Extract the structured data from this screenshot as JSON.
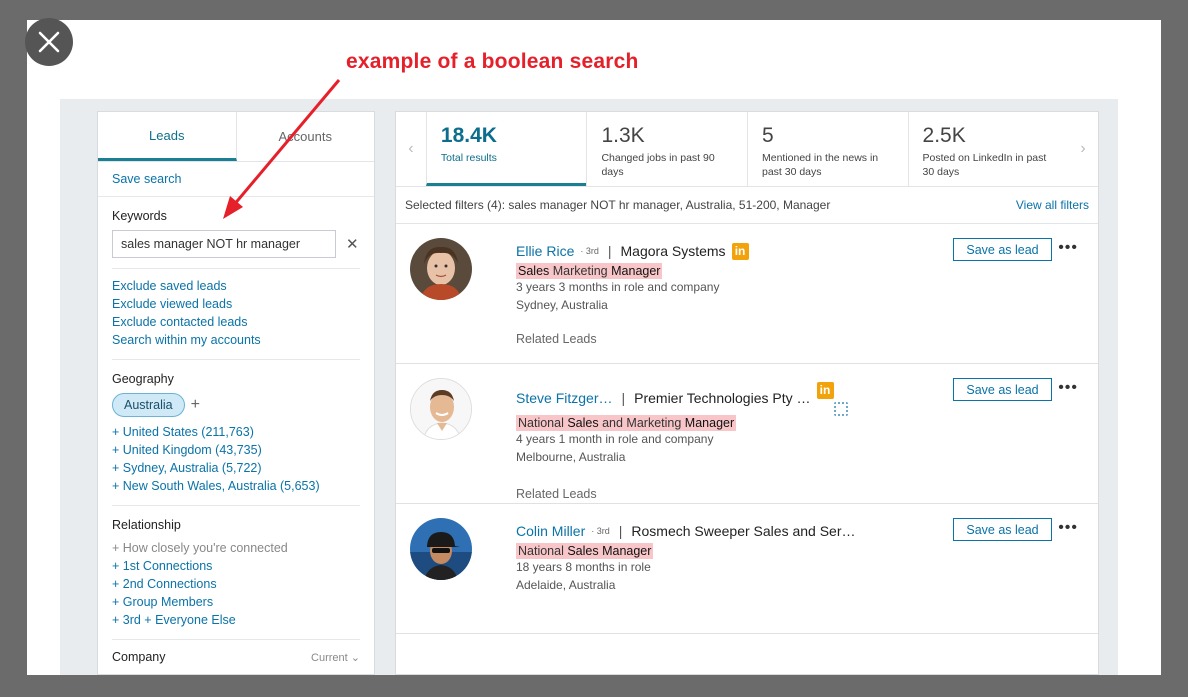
{
  "annotation": "example of a boolean search",
  "tabs": {
    "leads": "Leads",
    "accounts": "Accounts"
  },
  "left": {
    "save_search": "Save search",
    "keywords_title": "Keywords",
    "keywords_value": "sales manager NOT hr manager",
    "exclude_links": [
      "Exclude saved leads",
      "Exclude viewed leads",
      "Exclude contacted leads",
      "Search within my accounts"
    ],
    "geography_title": "Geography",
    "geography_selected": "Australia",
    "geography_options": [
      "+ United States (211,763)",
      "+ United Kingdom (43,735)",
      "+ Sydney, Australia (5,722)",
      "+ New South Wales, Australia (5,653)"
    ],
    "relationship_title": "Relationship",
    "relationship_hint": "How closely you're connected",
    "relationship_options": [
      "+ 1st Connections",
      "+ 2nd Connections",
      "+ Group Members",
      "+ 3rd + Everyone Else"
    ],
    "company_title": "Company",
    "company_current": "Current"
  },
  "stats": [
    {
      "value": "18.4K",
      "label": "Total results"
    },
    {
      "value": "1.3K",
      "label": "Changed jobs in past 90 days"
    },
    {
      "value": "5",
      "label": "Mentioned in the news in past 30 days"
    },
    {
      "value": "2.5K",
      "label": "Posted on LinkedIn in past 30 days"
    }
  ],
  "filters": {
    "text": "Selected filters (4):  sales manager NOT hr manager, Australia, 51-200, Manager",
    "view_all": "View all filters"
  },
  "leads": [
    {
      "name": "Ellie Rice",
      "degree": "3rd",
      "company": "Magora Systems",
      "title_parts": [
        "Sales",
        " Marketing ",
        "Manager"
      ],
      "tenure": "3 years 3 months in role and company",
      "location": "Sydney, Australia",
      "related": "Related Leads",
      "save": "Save as lead"
    },
    {
      "name": "Steve Fitzger…",
      "degree": "",
      "company": "Premier Technologies Pty …",
      "title_parts": [
        "National ",
        "Sales",
        " and Marketing ",
        "Manager"
      ],
      "tenure": "4 years 1 month in role and company",
      "location": "Melbourne, Australia",
      "related": "Related Leads",
      "save": "Save as lead"
    },
    {
      "name": "Colin Miller",
      "degree": "3rd",
      "company": "Rosmech Sweeper Sales and Ser…",
      "title_parts": [
        "National ",
        "Sales Manager"
      ],
      "tenure": "18 years 8 months in role",
      "location": "Adelaide, Australia",
      "related": "",
      "save": "Save as lead"
    }
  ],
  "icons": {
    "close": "close-icon",
    "linkedin": "linkedin-badge-icon",
    "more": "more-icon"
  },
  "colors": {
    "accent": "#0a73a8",
    "highlight": "#f8c6c9",
    "annotation": "#e6202a",
    "linkedin_badge": "#f2a20a"
  }
}
